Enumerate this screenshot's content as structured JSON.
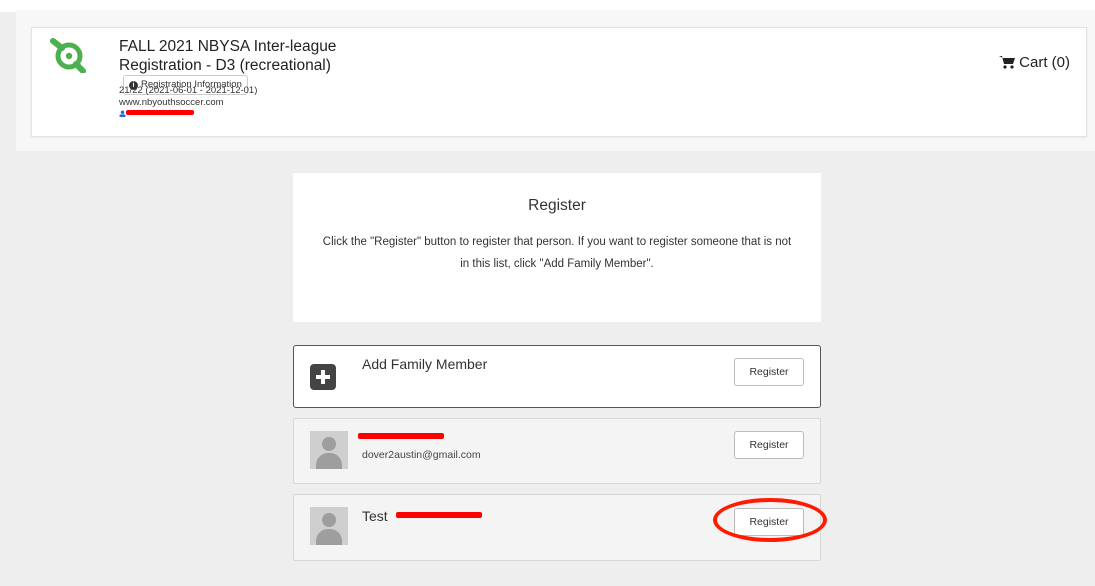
{
  "header": {
    "title": "FALL 2021 NBYSA Inter-league Registration - D3 (recreational)",
    "registration_info_label": "Registration Information",
    "season": "21/22 (2021-06-01 - 2021-12-01)",
    "website": "www.nbyouthsoccer.com",
    "cart_label": "Cart (0)"
  },
  "intro": {
    "heading": "Register",
    "text": "Click the \"Register\" button to register that person. If you want to register someone that is not in this list, click \"Add Family Member\"."
  },
  "rows": [
    {
      "name": "Add Family Member",
      "button": "Register"
    },
    {
      "name": "",
      "email": "dover2austin@gmail.com",
      "button": "Register"
    },
    {
      "name": "Test",
      "button": "Register"
    }
  ],
  "colors": {
    "redaction": "#ff0000",
    "annotation": "#ff1a00",
    "logo": "#4caf50"
  }
}
